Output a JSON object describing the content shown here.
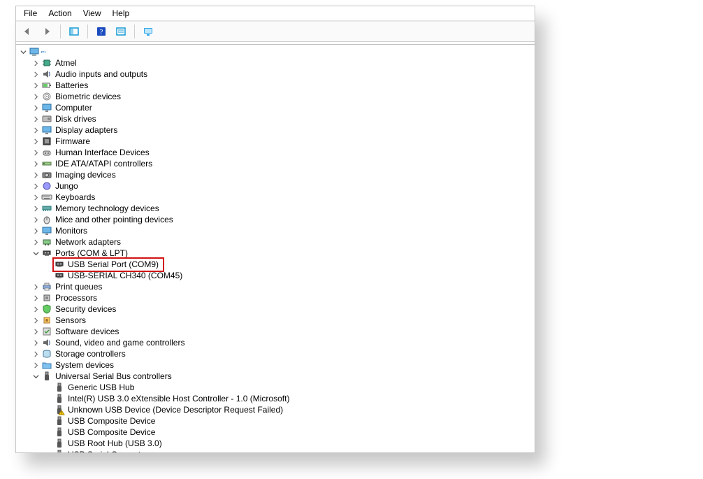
{
  "menu": {
    "file": "File",
    "action": "Action",
    "view": "View",
    "help": "Help"
  },
  "toolbar": {
    "back": "Back",
    "forward": "Forward",
    "console": "Show/Hide Console Tree",
    "help": "Help",
    "properties": "Properties",
    "refresh": "Scan for hardware changes"
  },
  "root": {
    "label": ""
  },
  "nodes": {
    "atmel": "Atmel",
    "audio": "Audio inputs and outputs",
    "batteries": "Batteries",
    "biometric": "Biometric devices",
    "computer": "Computer",
    "disk": "Disk drives",
    "display": "Display adapters",
    "firmware": "Firmware",
    "hid": "Human Interface Devices",
    "ide": "IDE ATA/ATAPI controllers",
    "imaging": "Imaging devices",
    "jungo": "Jungo",
    "keyboards": "Keyboards",
    "memtech": "Memory technology devices",
    "mice": "Mice and other pointing devices",
    "monitors": "Monitors",
    "netadapt": "Network adapters",
    "ports": "Ports (COM & LPT)",
    "port_usb9": "USB Serial Port (COM9)",
    "port_ch340": "USB-SERIAL CH340 (COM45)",
    "printq": "Print queues",
    "proc": "Processors",
    "sec": "Security devices",
    "sensors": "Sensors",
    "soft": "Software devices",
    "svg": "Sound, video and game controllers",
    "storage": "Storage controllers",
    "sysdev": "System devices",
    "usb": "Universal Serial Bus controllers",
    "usb_hub": "Generic USB Hub",
    "usb_xhci": "Intel(R) USB 3.0 eXtensible Host Controller - 1.0 (Microsoft)",
    "usb_unknown": "Unknown USB Device (Device Descriptor Request Failed)",
    "usb_comp1": "USB Composite Device",
    "usb_comp2": "USB Composite Device",
    "usb_root": "USB Root Hub (USB 3.0)",
    "usb_serial": "USB Serial Converter"
  }
}
